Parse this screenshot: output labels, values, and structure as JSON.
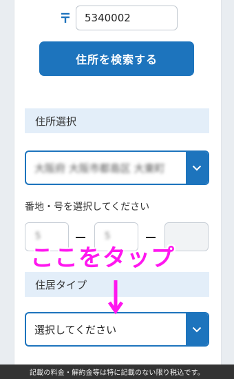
{
  "postal": {
    "mark": "〒",
    "value": "5340002"
  },
  "search_button": "住所を検索する",
  "address_section": {
    "heading": "住所選択",
    "selected_value": "大阪府 大阪市都島区 大東町"
  },
  "block_section": {
    "label": "番地・号を選択してください",
    "fields": [
      "5",
      "5",
      ""
    ]
  },
  "annotation": {
    "text": "ここをタップ",
    "color": "#ff17ef"
  },
  "residence_section": {
    "heading": "住居タイプ",
    "placeholder": "選択してください"
  },
  "footer_note": "記載の料金・解約金等は特に記載のない限り税込です。",
  "colors": {
    "accent": "#1d74bd",
    "section_bg": "#e3eef9"
  }
}
